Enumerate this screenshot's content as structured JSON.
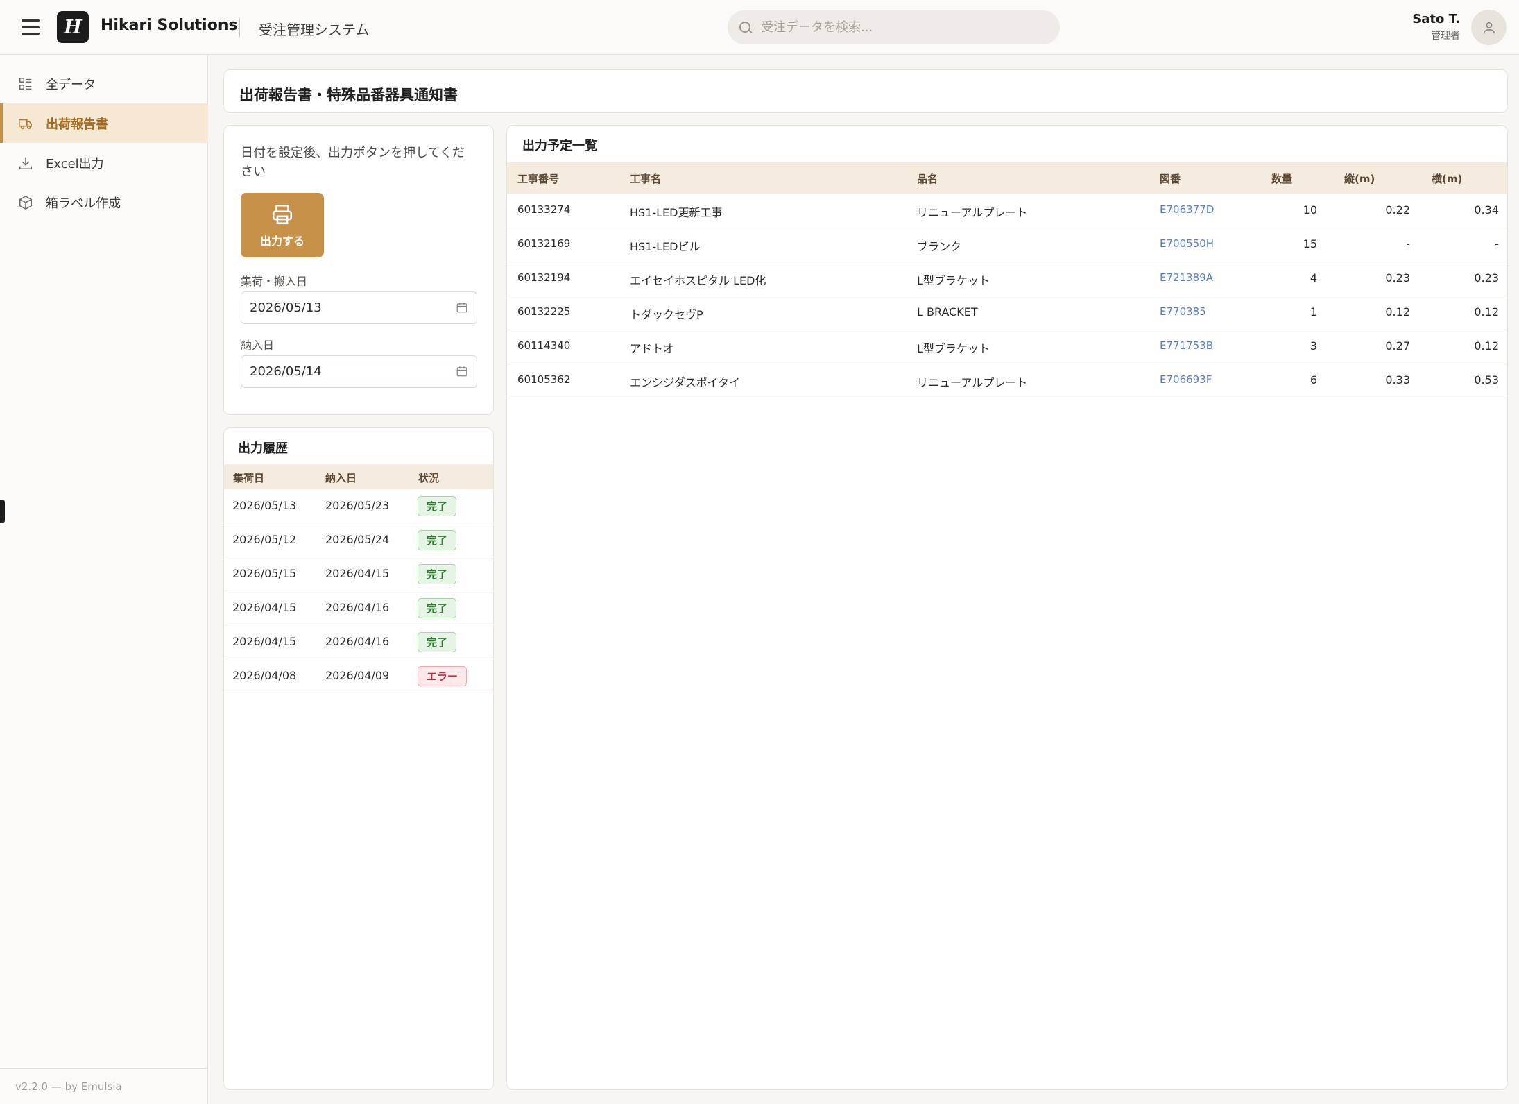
{
  "header": {
    "logo_letter": "H",
    "brand": "Hikari Solutions",
    "app_name": "受注管理システム",
    "search_placeholder": "受注データを検索...",
    "user_name": "Sato T.",
    "user_role": "管理者"
  },
  "sidebar": {
    "items": [
      {
        "label": "全データ",
        "icon": "grid-list-icon"
      },
      {
        "label": "出荷報告書",
        "icon": "truck-icon",
        "active": true
      },
      {
        "label": "Excel出力",
        "icon": "download-icon"
      },
      {
        "label": "箱ラベル作成",
        "icon": "box-icon"
      }
    ],
    "footer": "v2.2.0 — by Emulsia"
  },
  "page": {
    "title": "出荷報告書・特殊品番器具通知書"
  },
  "controls": {
    "instruction": "日付を設定後、出力ボタンを押してください",
    "export_button": "出力する",
    "pickup_label": "集荷・搬入日",
    "pickup_value": "2026/05/13",
    "delivery_label": "納入日",
    "delivery_value": "2026/05/14"
  },
  "history": {
    "title": "出力履歴",
    "columns": [
      "集荷日",
      "納入日",
      "状況"
    ],
    "rows": [
      {
        "pickup": "2026/05/13",
        "delivery": "2026/05/23",
        "status": "完了",
        "state": "ok"
      },
      {
        "pickup": "2026/05/12",
        "delivery": "2026/05/24",
        "status": "完了",
        "state": "ok"
      },
      {
        "pickup": "2026/05/15",
        "delivery": "2026/04/15",
        "status": "完了",
        "state": "ok"
      },
      {
        "pickup": "2026/04/15",
        "delivery": "2026/04/16",
        "status": "完了",
        "state": "ok"
      },
      {
        "pickup": "2026/04/15",
        "delivery": "2026/04/16",
        "status": "完了",
        "state": "ok"
      },
      {
        "pickup": "2026/04/08",
        "delivery": "2026/04/09",
        "status": "エラー",
        "state": "err"
      }
    ]
  },
  "schedule": {
    "title": "出力予定一覧",
    "columns": [
      "工事番号",
      "工事名",
      "品名",
      "図番",
      "数量",
      "縦(m)",
      "横(m)"
    ],
    "rows": [
      {
        "no": "60133274",
        "name": "HS1-LED更新工事",
        "item": "リニューアルプレート",
        "drawing": "E706377D",
        "qty": "10",
        "h": "0.22",
        "w": "0.34"
      },
      {
        "no": "60132169",
        "name": "HS1-LEDビル",
        "item": "ブランク",
        "drawing": "E700550H",
        "qty": "15",
        "h": "-",
        "w": "-"
      },
      {
        "no": "60132194",
        "name": "エイセイホスピタル LED化",
        "item": "L型ブラケット",
        "drawing": "E721389A",
        "qty": "4",
        "h": "0.23",
        "w": "0.23"
      },
      {
        "no": "60132225",
        "name": "トダックセヴP",
        "item": "L BRACKET",
        "drawing": "E770385",
        "qty": "1",
        "h": "0.12",
        "w": "0.12"
      },
      {
        "no": "60114340",
        "name": "アドトオ",
        "item": "L型ブラケット",
        "drawing": "E771753B",
        "qty": "3",
        "h": "0.27",
        "w": "0.12"
      },
      {
        "no": "60105362",
        "name": "エンシジダスポイタイ",
        "item": "リニューアルプレート",
        "drawing": "E706693F",
        "qty": "6",
        "h": "0.33",
        "w": "0.53"
      }
    ]
  },
  "colors": {
    "accent": "#c8914a",
    "active_bg": "#f6e8d3",
    "link": "#5b7fc6",
    "ok": "#2f7a31",
    "error": "#c0303d"
  }
}
